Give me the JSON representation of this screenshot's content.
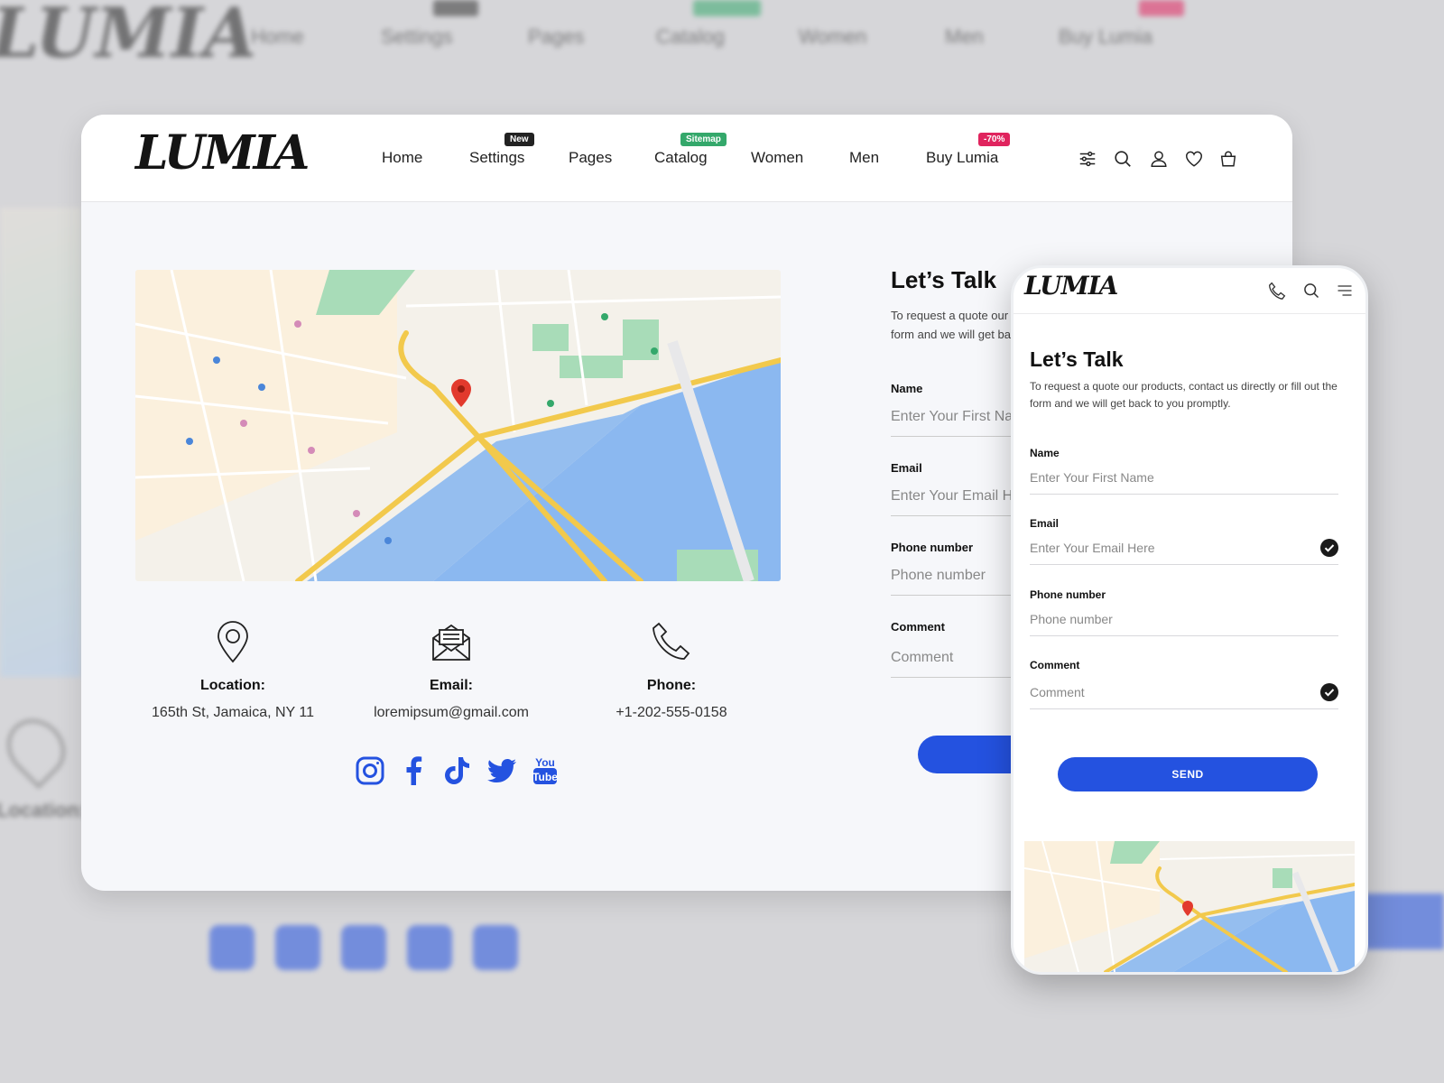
{
  "brand": {
    "logo_text": "LUMIA"
  },
  "nav": {
    "items": [
      {
        "label": "Home",
        "badge": ""
      },
      {
        "label": "Settings",
        "badge": "New"
      },
      {
        "label": "Pages",
        "badge": ""
      },
      {
        "label": "Catalog",
        "badge": "Sitemap"
      },
      {
        "label": "Women",
        "badge": ""
      },
      {
        "label": "Men",
        "badge": ""
      },
      {
        "label": "Buy Lumia",
        "badge": "-70%"
      }
    ],
    "badge_colors": {
      "New": "#222222",
      "Sitemap": "#34a86b",
      "-70%": "#e0245e"
    },
    "icons": [
      "filter-icon",
      "search-icon",
      "user-icon",
      "heart-icon",
      "cart-icon"
    ]
  },
  "contact": {
    "location": {
      "label": "Location:",
      "value": "165th St, Jamaica, NY 11"
    },
    "email": {
      "label": "Email:",
      "value": "loremipsum@gmail.com"
    },
    "phone": {
      "label": "Phone:",
      "value": "+1-202-555-0158"
    },
    "socials": [
      "instagram-icon",
      "facebook-icon",
      "tiktok-icon",
      "twitter-icon",
      "youtube-icon"
    ]
  },
  "form": {
    "title": "Let’s Talk",
    "description_line1": "To request a quote our products, contact us directly or fill out the",
    "description_line2": "form and we will get back to you promptly.",
    "name_label": "Name",
    "name_placeholder": "Enter Your First Name",
    "email_label": "Email",
    "email_placeholder": "Enter Your Email Here",
    "phone_label": "Phone number",
    "phone_placeholder": "Phone number",
    "comment_label": "Comment",
    "comment_placeholder": "Comment",
    "send_label": "SEND"
  },
  "colors": {
    "accent": "#2452e0",
    "water": "#8bb8f0",
    "road": "#f2c94c",
    "park": "#a8dcb8"
  }
}
